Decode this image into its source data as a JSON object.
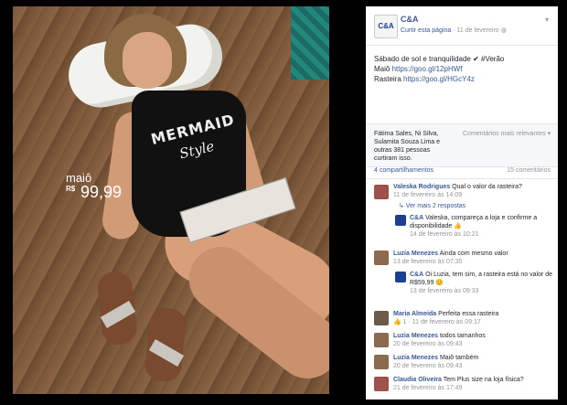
{
  "ad": {
    "product_name": "maiô",
    "currency": "R$",
    "price": "99,99",
    "suit_line1": "MERMAID",
    "suit_line2": "Style"
  },
  "page": {
    "name": "C&A",
    "logo_text": "C&A",
    "like_page": "Curtir esta página",
    "date": "11 de fevereiro",
    "separator": " · "
  },
  "post": {
    "line1": "Sábado de sol e tranquilidade ✔ #Verão",
    "line2_label": "Maiô",
    "line2_url": "https://goo.gl/12pHWf",
    "line3_label": "Rasteira",
    "line3_url": "https://goo.gl/HGcY4z"
  },
  "likes": {
    "text": "Fátima Sales, Ni Silva, Sulamita Souza Lima e outras 381 pessoas curtiram isso.",
    "filter": "Comentários mais relevantes ▾"
  },
  "stats": {
    "shares": "4 compartilhamentos",
    "comments": "15 comentários"
  },
  "comments": [
    {
      "author": "Valeska Rodrigues",
      "text": "Qual o valor da rasteira?",
      "meta": "11 de fevereiro às 14:09"
    },
    {
      "more": "↳ Ver mais 2 respostas"
    },
    {
      "author": "C&A",
      "text": "Valeska, compareça a loja e confirme a disponibilidade 👍",
      "meta": "14 de fevereiro às 10:21"
    },
    {
      "author": "Luzia Menezes",
      "text": "Ainda com mesmo valor",
      "meta": "13 de fevereiro às 07:35"
    },
    {
      "author": "C&A",
      "text": "Oi Luzia, tem sim, a rasteira está no valor de R$59,99 😊",
      "meta": "13 de fevereiro às 09:33"
    },
    {
      "author": "Maria Almeida",
      "text": "Perfeita essa rasteira",
      "meta": "👍 1 · 11 de fevereiro às 09:17"
    },
    {
      "author": "Luzia Menezes",
      "text": "todos tamanhos",
      "meta": "20 de fevereiro às 09:43"
    },
    {
      "author": "Luzia Menezes",
      "text": "Maiô também",
      "meta": "20 de fevereiro às 09:43"
    },
    {
      "author": "Claudia Oliveira",
      "text": "Tem Plus size na loja física?",
      "meta": "21 de fevereiro às 17:49"
    }
  ]
}
